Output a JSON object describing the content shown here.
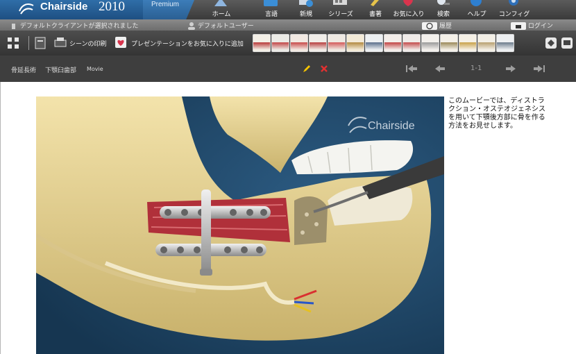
{
  "brand": {
    "name": "Chairside",
    "year": "2010",
    "edition": "Premium"
  },
  "nav": [
    {
      "label": "ホーム",
      "icon": "home-icon"
    },
    {
      "label": "言語",
      "icon": "language-icon"
    },
    {
      "label": "新規",
      "icon": "new-icon"
    },
    {
      "label": "シリーズ",
      "icon": "series-icon"
    },
    {
      "label": "書著",
      "icon": "book-icon"
    },
    {
      "label": "お気に入り",
      "icon": "favorites-icon"
    },
    {
      "label": "検索",
      "icon": "search-icon"
    },
    {
      "label": "ヘルプ",
      "icon": "help-icon"
    },
    {
      "label": "コンフィグ",
      "icon": "config-icon"
    }
  ],
  "status": {
    "client": "デフォルトクライアントが選択されました",
    "user": "デフォルトユーザー",
    "history": "履歴",
    "login": "ログイン"
  },
  "toolbar": {
    "print": "シーンの印刷",
    "favorite_presentation": "プレゼンテーションをお気に入りに追加"
  },
  "title": {
    "procedure": "骨延長術",
    "region": "下顎臼歯部",
    "media_type": "Movie",
    "page": "1-1"
  },
  "video": {
    "watermark": "Chairside"
  },
  "description": "このムービーでは、ディストラクション・オステオジェネシスを用いて下顎後方部に骨を作る方法をお見せします。",
  "colors": {
    "header_dark": "#3a3a3a",
    "brand_blue": "#2a5f93",
    "video_bg": "#1d3e5c",
    "bone": "#e8d69a"
  }
}
